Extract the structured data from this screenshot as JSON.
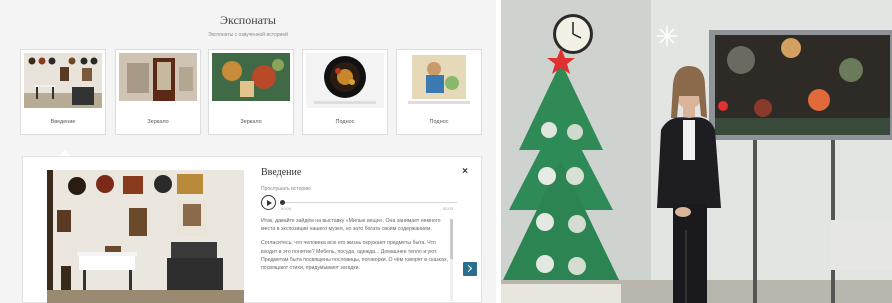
{
  "page": {
    "title": "Экспонаты",
    "subtitle": "Экспонаты с озвученной историей"
  },
  "exhibits": [
    {
      "label": "Введение",
      "active": true
    },
    {
      "label": "Зеркало",
      "active": false
    },
    {
      "label": "Зеркало",
      "active": false
    },
    {
      "label": "Поднос",
      "active": false
    },
    {
      "label": "Поднос",
      "active": false
    }
  ],
  "detail": {
    "title": "Введение",
    "close_icon": "×",
    "listen_label": "Прослушать историю",
    "time_start": "00:00",
    "time_end": "02:03",
    "progress": 0.0,
    "paragraphs": [
      "Итак, давайте зайдём на выставку «Милые вещи». Она занимает немного места в экспозиции нашего музея, но зато богата своим содержанием.",
      "Согласитесь, что человека всю его жизнь окружают предметы быта. Что входит в это понятие? Мебель, посуда, одежда... Домашнее тепло и уют. Предметам быта посвящены пословицы, поговорки. О чём говорят в сказках, посвящают стихи, придумывают загадки."
    ]
  },
  "icons": {
    "play": "play-icon",
    "close": "close-icon",
    "next": "chevron-right-icon"
  },
  "colors": {
    "next_button": "#2b6f8f",
    "tree": "#2e8b57",
    "star": "#e03030"
  }
}
